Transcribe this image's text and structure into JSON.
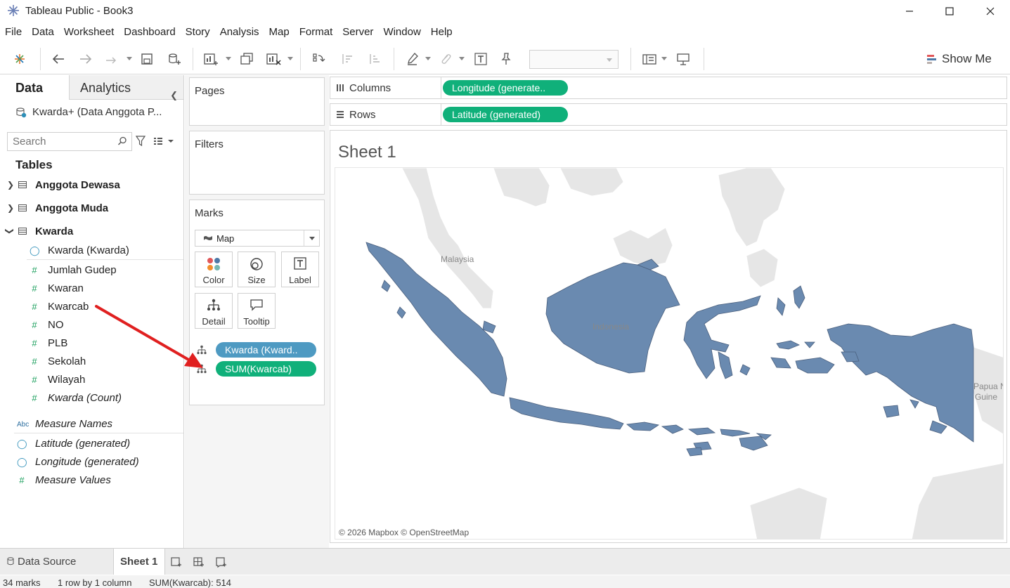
{
  "window": {
    "title": "Tableau Public - Book3"
  },
  "menu": [
    "File",
    "Data",
    "Worksheet",
    "Dashboard",
    "Story",
    "Analysis",
    "Map",
    "Format",
    "Server",
    "Window",
    "Help"
  ],
  "toolbar": {
    "show_me_label": "Show Me"
  },
  "data_pane": {
    "tab_data": "Data",
    "tab_analytics": "Analytics",
    "datasource": "Kwarda+ (Data Anggota P...",
    "search_placeholder": "Search",
    "tables_header": "Tables",
    "tables": [
      {
        "name": "Anggota Dewasa",
        "expanded": false
      },
      {
        "name": "Anggota Muda",
        "expanded": false
      },
      {
        "name": "Kwarda",
        "expanded": true
      }
    ],
    "kwarda_fields": [
      {
        "name": "Kwarda (Kwarda)",
        "type": "geo"
      },
      {
        "name": "Jumlah Gudep",
        "type": "measure"
      },
      {
        "name": "Kwaran",
        "type": "measure"
      },
      {
        "name": "Kwarcab",
        "type": "measure"
      },
      {
        "name": "NO",
        "type": "measure"
      },
      {
        "name": "PLB",
        "type": "measure"
      },
      {
        "name": "Sekolah",
        "type": "measure"
      },
      {
        "name": "Wilayah",
        "type": "measure"
      },
      {
        "name": "Kwarda (Count)",
        "type": "measure"
      }
    ],
    "generated_fields": [
      {
        "name": "Measure Names",
        "type": "abc"
      },
      {
        "name": "Latitude (generated)",
        "type": "geo"
      },
      {
        "name": "Longitude (generated)",
        "type": "geo"
      },
      {
        "name": "Measure Values",
        "type": "measure"
      }
    ]
  },
  "cards": {
    "pages_title": "Pages",
    "filters_title": "Filters",
    "marks_title": "Marks",
    "marks_type": "Map",
    "mark_buttons": [
      "Color",
      "Size",
      "Label",
      "Detail",
      "Tooltip"
    ],
    "mark_pills": [
      "Kwarda (Kward..",
      "SUM(Kwarcab)"
    ]
  },
  "shelves": {
    "columns_label": "Columns",
    "columns_pill": "Longitude (generate..",
    "rows_label": "Rows",
    "rows_pill": "Latitude (generated)"
  },
  "view": {
    "sheet_title": "Sheet 1",
    "map_labels": [
      "Malaysia",
      "Indonesia",
      "Papua N",
      "Guine"
    ],
    "attribution": "© 2026 Mapbox © OpenStreetMap",
    "fill_color": "#6a8ab0"
  },
  "bottom_tabs": {
    "data_source": "Data Source",
    "sheet1": "Sheet 1"
  },
  "status": {
    "marks": "34 marks",
    "rows_cols": "1 row by 1 column",
    "sum": "SUM(Kwarcab): 514"
  },
  "annotation": {
    "arrow_color": "#e02020"
  }
}
